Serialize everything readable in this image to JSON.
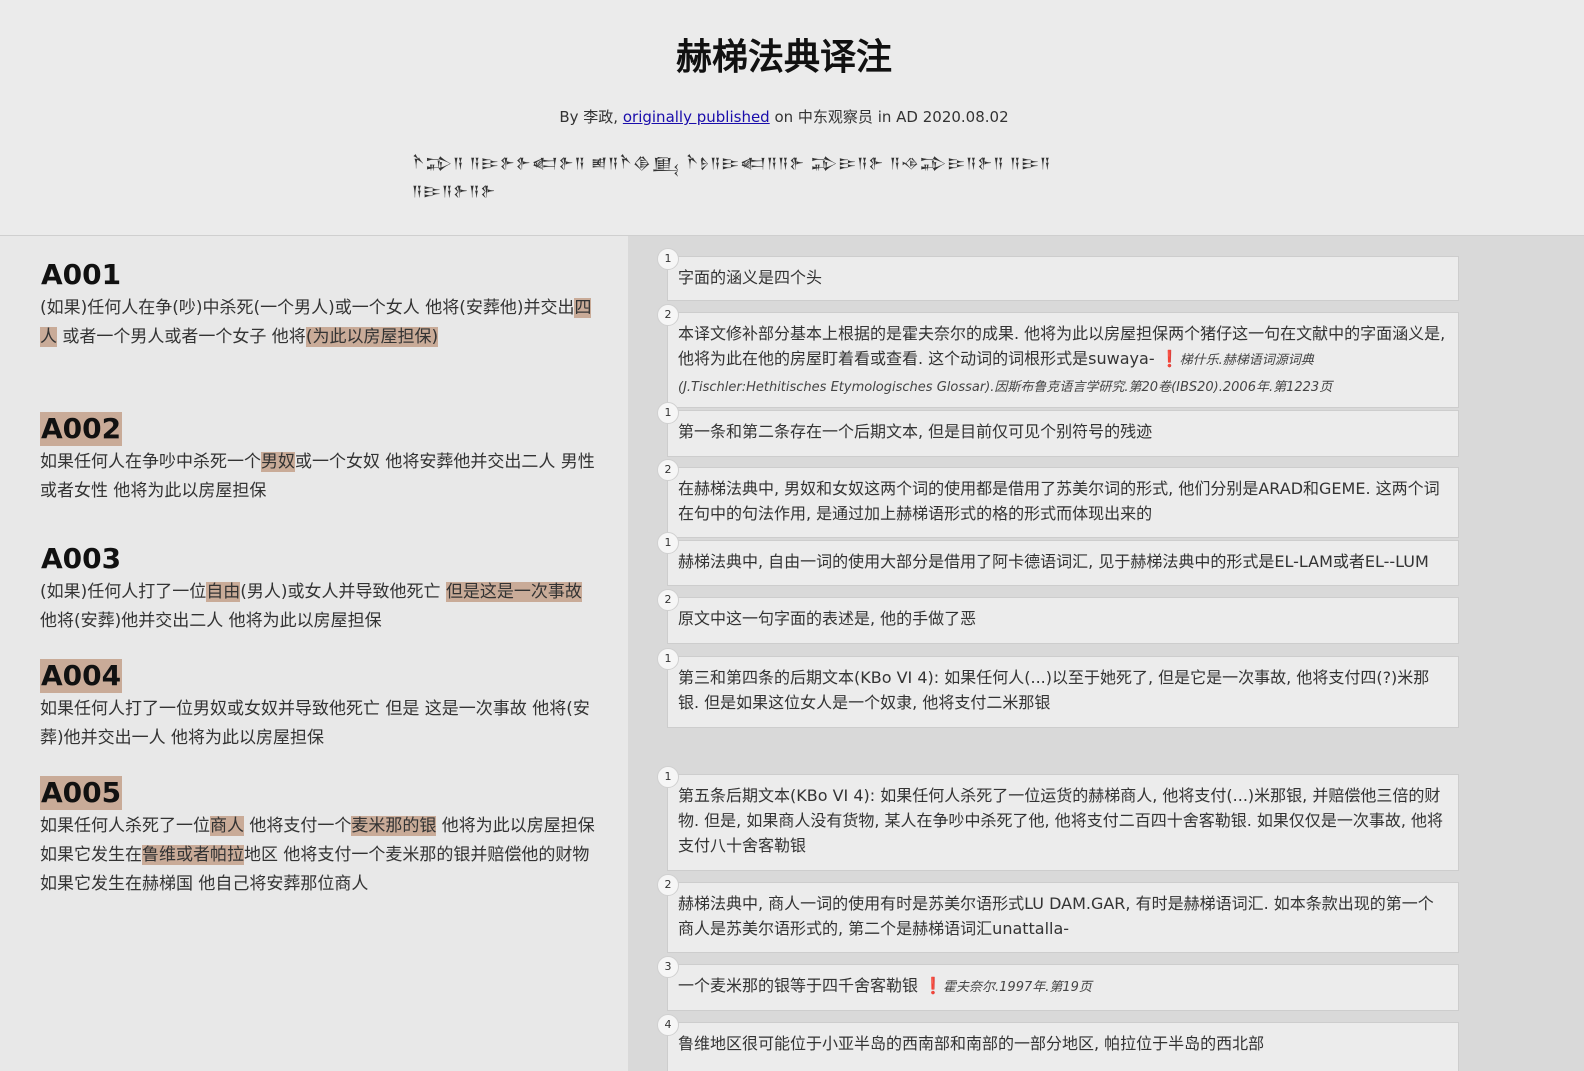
{
  "header": {
    "title": "赫梯法典译注",
    "byline_prefix": "By 李政,",
    "byline_link": "originally published",
    "byline_suffix": "on 中东观察员 in AD 2020.08.02",
    "cuneiform_line1": "𒋻𒁉𒀀 𒀀𒄿𒉿𒉿𒅗𒉿𒀀 𒅖𒀀𒋻𒆠𒅅 𒋻𒊩𒀀𒄿𒅗𒀀𒀀𒉿 𒁉𒄿𒀀𒉿 𒀀𒈾𒁉𒄿𒀀𒉿𒀀 𒀀𒄿𒀀",
    "cuneiform_line2": "𒀀𒄿𒀀𒉿𒀀𒉿"
  },
  "articles": [
    {
      "id": "A001",
      "parts": [
        {
          "t": "(如果)任何人在争(吵)中杀死(一个男人)或一个女人  他将(安葬他)并交出",
          "h": false
        },
        {
          "t": "四人",
          "h": true
        },
        {
          "t": "  或者一个男人或者一个女子  他将",
          "h": false
        },
        {
          "t": "(为此以房屋担保)",
          "h": true
        }
      ]
    },
    {
      "id": "A002",
      "parts": [
        {
          "t": "如果任何人在争吵中杀死一个",
          "h": false
        },
        {
          "t": "男奴",
          "h": true
        },
        {
          "t": "或一个女奴  他将安葬他并交出二人  男性或者女性  他将为此以房屋担保",
          "h": false
        }
      ]
    },
    {
      "id": "A003",
      "parts": [
        {
          "t": "(如果)任何人打了一位",
          "h": false
        },
        {
          "t": "自由",
          "h": true
        },
        {
          "t": "(男人)或女人并导致他死亡  ",
          "h": false
        },
        {
          "t": "但是这是一次事故",
          "h": true
        },
        {
          "t": "  他将(安葬)他并交出二人  他将为此以房屋担保",
          "h": false
        }
      ]
    },
    {
      "id": "A004",
      "parts": [
        {
          "t": "如果任何人打了一位男奴或女奴并导致他死亡  但是  这是一次事故  他将(安葬)他并交出一人  他将为此以房屋担保",
          "h": false
        }
      ]
    },
    {
      "id": "A005",
      "parts": [
        {
          "t": "如果任何人杀死了一位",
          "h": false
        },
        {
          "t": "商人",
          "h": true
        },
        {
          "t": "  他将支付一个",
          "h": false
        },
        {
          "t": "麦米那的银",
          "h": true
        },
        {
          "t": "  他将为此以房屋担保  如果它发生在",
          "h": false
        },
        {
          "t": "鲁维或者帕拉",
          "h": true
        },
        {
          "t": "地区  他将支付一个麦米那的银并赔偿他的财物  如果它发生在赫梯国  他自己将安葬那位商人",
          "h": false
        }
      ]
    }
  ],
  "notes": [
    {
      "num": "1",
      "text": "字面的涵义是四个头",
      "cite": ""
    },
    {
      "num": "2",
      "text": "本译文修补部分基本上根据的是霍夫奈尔的成果. 他将为此以房屋担保两个猪仔这一句在文献中的字面涵义是, 他将为此在他的房屋盯着看或查看. 这个动词的词根形式是suwaya- ",
      "cite": "梯什乐.赫梯语词源词典(J.Tischler:Hethitisches Etymologisches Glossar).因斯布鲁克语言学研究.第20卷(IBS20).2006年.第1223页"
    },
    {
      "num": "1",
      "text": "第一条和第二条存在一个后期文本, 但是目前仅可见个别符号的残迹",
      "cite": ""
    },
    {
      "num": "2",
      "text": "在赫梯法典中, 男奴和女奴这两个词的使用都是借用了苏美尔词的形式, 他们分别是ARAD和GEME. 这两个词在句中的句法作用, 是通过加上赫梯语形式的格的形式而体现出来的",
      "cite": ""
    },
    {
      "num": "1",
      "text": "赫梯法典中, 自由一词的使用大部分是借用了阿卡德语词汇, 见于赫梯法典中的形式是EL-LAM或者EL--LUM",
      "cite": ""
    },
    {
      "num": "2",
      "text": "原文中这一句字面的表述是, 他的手做了恶",
      "cite": ""
    },
    {
      "num": "1",
      "text": "第三和第四条的后期文本(KBo VI 4): 如果任何人(...)以至于她死了, 但是它是一次事故, 他将支付四(?)米那银. 但是如果这位女人是一个奴隶, 他将支付二米那银",
      "cite": ""
    },
    {
      "num": "1",
      "text": "第五条后期文本(KBo VI 4): 如果任何人杀死了一位运货的赫梯商人, 他将支付(...)米那银, 并赔偿他三倍的财物. 但是, 如果商人没有货物, 某人在争吵中杀死了他, 他将支付二百四十舍客勒银. 如果仅仅是一次事故, 他将支付八十舍客勒银",
      "cite": ""
    },
    {
      "num": "2",
      "text": "赫梯法典中, 商人一词的使用有时是苏美尔语形式LU DAM.GAR, 有时是赫梯语词汇. 如本条款出现的第一个商人是苏美尔语形式的, 第二个是赫梯语词汇unattalla-",
      "cite": ""
    },
    {
      "num": "3",
      "text": "一个麦米那的银等于四千舍客勒银 ",
      "cite": "霍夫奈尔.1997年.第19页"
    },
    {
      "num": "4",
      "text": "鲁维地区很可能位于小亚半岛的西南部和南部的一部分地区, 帕拉位于半岛的西北部",
      "cite": ""
    }
  ]
}
